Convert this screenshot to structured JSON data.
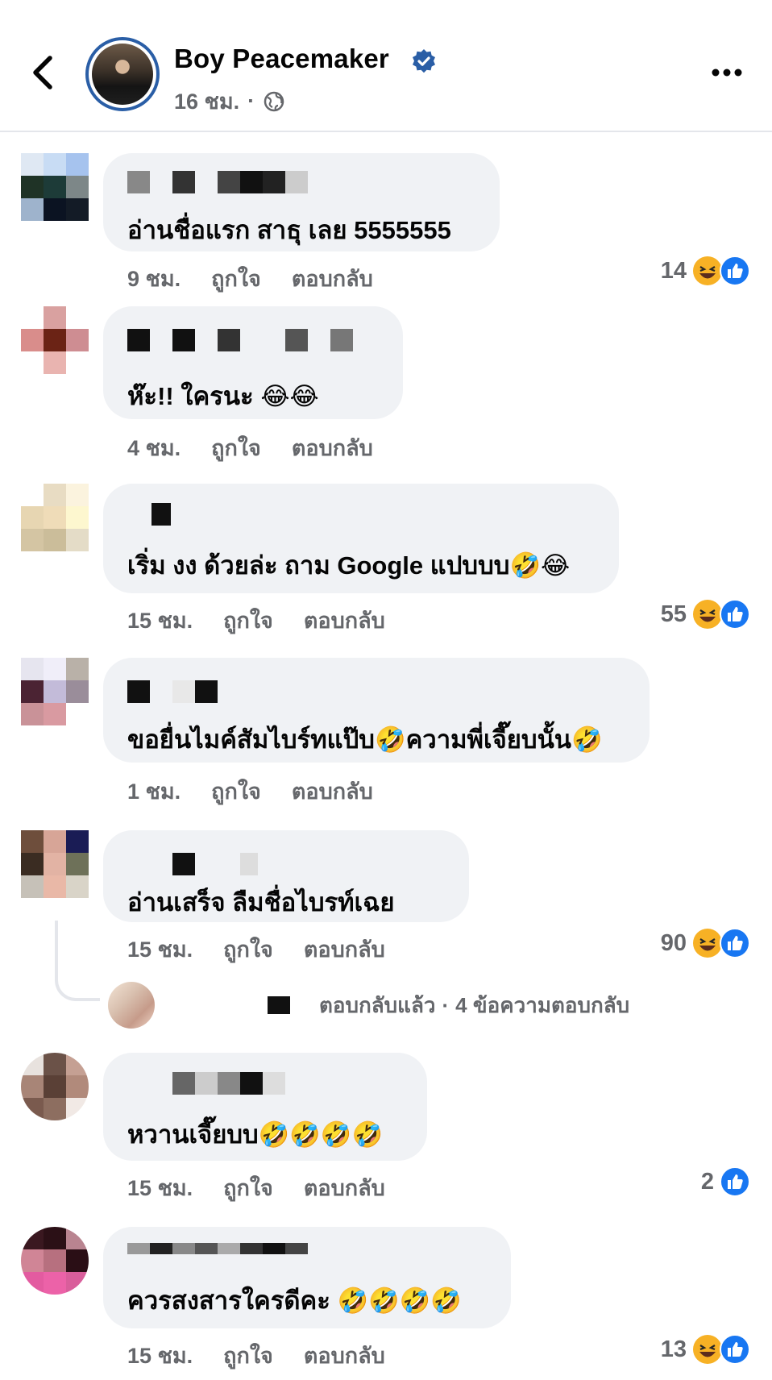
{
  "header": {
    "page_name": "Boy Peacemaker",
    "time": "16 ชม.",
    "separator": "·",
    "icons": [
      "back-arrow-icon",
      "verified-badge-icon",
      "globe-icon",
      "more-icon"
    ]
  },
  "comments": [
    {
      "text": "อ่านชื่อแรก สาธุ เลย 5555555",
      "time": "9 ชม.",
      "like": "ถูกใจ",
      "reply": "ตอบกลับ",
      "reaction_count": "14",
      "reactions": [
        "laugh",
        "like"
      ]
    },
    {
      "text": "ห๊ะ!! ใครนะ 😂😂",
      "time": "4 ชม.",
      "like": "ถูกใจ",
      "reply": "ตอบกลับ",
      "reaction_count": "",
      "reactions": []
    },
    {
      "text": "เริ่ม งง ด้วยล่ะ ถาม Google แปบบบ🤣😂",
      "time": "15 ชม.",
      "like": "ถูกใจ",
      "reply": "ตอบกลับ",
      "reaction_count": "55",
      "reactions": [
        "laugh",
        "like"
      ]
    },
    {
      "text": "ขอยื่นไมค์สัมไบร์ทแป๊บ🤣ความพี่เจี๊ยบนั้น🤣",
      "time": "1 ชม.",
      "like": "ถูกใจ",
      "reply": "ตอบกลับ",
      "reaction_count": "",
      "reactions": []
    },
    {
      "text": "อ่านเสร็จ ลืมชื่อไบรท์เฉย",
      "time": "15 ชม.",
      "like": "ถูกใจ",
      "reply": "ตอบกลับ",
      "reaction_count": "90",
      "reactions": [
        "laugh",
        "like"
      ]
    },
    {
      "text": "หวานเจี๊ยบบ🤣🤣🤣🤣",
      "time": "15 ชม.",
      "like": "ถูกใจ",
      "reply": "ตอบกลับ",
      "reaction_count": "2",
      "reactions": [
        "like"
      ]
    },
    {
      "text": "ควรสงสารใครดีคะ 🤣🤣🤣🤣",
      "time": "15 ชม.",
      "like": "ถูกใจ",
      "reply": "ตอบกลับ",
      "reaction_count": "13",
      "reactions": [
        "laugh",
        "like"
      ]
    }
  ],
  "reply_summary": {
    "replied_label": "ตอบกลับแล้ว",
    "separator": "·",
    "count_label": "4 ข้อความตอบกลับ"
  },
  "colors": {
    "bubble": "#f0f2f5",
    "secondary_text": "#65676b",
    "facebook_blue": "#1877f2",
    "verified_blue": "#2a5ea6"
  }
}
